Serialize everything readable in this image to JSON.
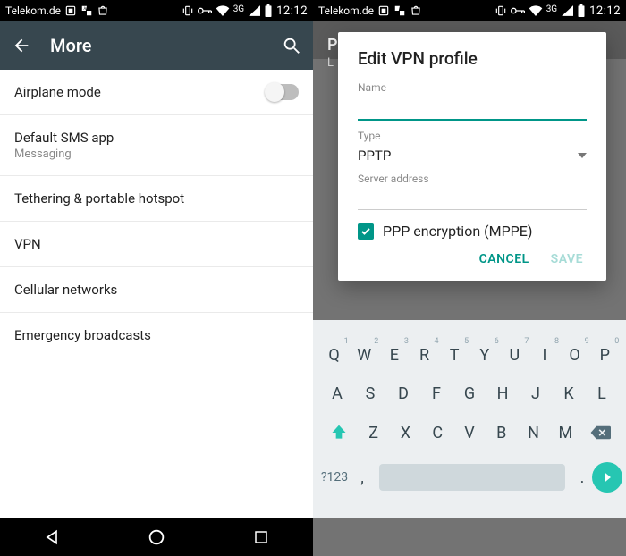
{
  "status": {
    "carrier": "Telekom.de",
    "net": "3G",
    "time": "12:12"
  },
  "left": {
    "appbar_title": "More",
    "items": [
      {
        "label": "Airplane mode",
        "sub": "",
        "toggle": true
      },
      {
        "label": "Default SMS app",
        "sub": "Messaging"
      },
      {
        "label": "Tethering & portable hotspot",
        "sub": ""
      },
      {
        "label": "VPN",
        "sub": ""
      },
      {
        "label": "Cellular networks",
        "sub": ""
      },
      {
        "label": "Emergency broadcasts",
        "sub": ""
      }
    ]
  },
  "right": {
    "behind_line1": "P",
    "behind_line2": "L",
    "dialog": {
      "title": "Edit VPN profile",
      "name_label": "Name",
      "name_value": "",
      "type_label": "Type",
      "type_value": "PPTP",
      "server_label": "Server address",
      "server_value": "",
      "ppe_checked": true,
      "ppe_label": "PPP encryption (MPPE)",
      "cancel": "CANCEL",
      "save": "SAVE"
    }
  },
  "keyboard": {
    "row1": [
      "Q",
      "W",
      "E",
      "R",
      "T",
      "Y",
      "U",
      "I",
      "O",
      "P"
    ],
    "row1_hints": [
      "1",
      "2",
      "3",
      "4",
      "5",
      "6",
      "7",
      "8",
      "9",
      "0"
    ],
    "row2": [
      "A",
      "S",
      "D",
      "F",
      "G",
      "H",
      "J",
      "K",
      "L"
    ],
    "row3": [
      "Z",
      "X",
      "C",
      "V",
      "B",
      "N",
      "M"
    ],
    "sym": "?123",
    "comma": ",",
    "dot": "."
  },
  "colors": {
    "accent": "#009688"
  }
}
